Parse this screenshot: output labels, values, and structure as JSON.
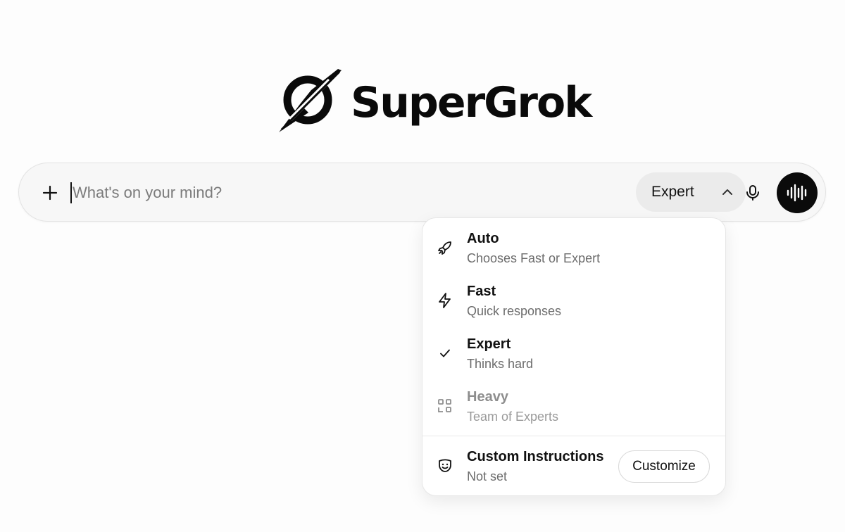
{
  "logo": {
    "text": "SuperGrok",
    "icon": "grok-logo-icon"
  },
  "composer": {
    "placeholder": "What's on your mind?",
    "attach_icon": "plus-icon",
    "model_selected": "Expert",
    "model_chevron_icon": "chevron-up-icon",
    "mic_icon": "microphone-icon",
    "voice_icon": "voice-waveform-icon"
  },
  "menu": {
    "items": [
      {
        "title": "Auto",
        "subtitle": "Chooses Fast or Expert",
        "icon": "rocket-icon",
        "selected": false,
        "disabled": false
      },
      {
        "title": "Fast",
        "subtitle": "Quick responses",
        "icon": "lightning-icon",
        "selected": false,
        "disabled": false
      },
      {
        "title": "Expert",
        "subtitle": "Thinks hard",
        "icon": "check-icon",
        "selected": true,
        "disabled": false
      },
      {
        "title": "Heavy",
        "subtitle": "Team of Experts",
        "icon": "squares-icon",
        "selected": false,
        "disabled": true
      }
    ],
    "custom": {
      "title": "Custom Instructions",
      "subtitle": "Not set",
      "icon": "theater-mask-icon",
      "button_label": "Customize"
    }
  },
  "colors": {
    "background": "#fdfdfd",
    "composer_bg": "#f7f7f7",
    "model_pill_bg": "#ebebeb",
    "voice_button_bg": "#0b0b0b",
    "muted_text": "#6c6c6c"
  }
}
